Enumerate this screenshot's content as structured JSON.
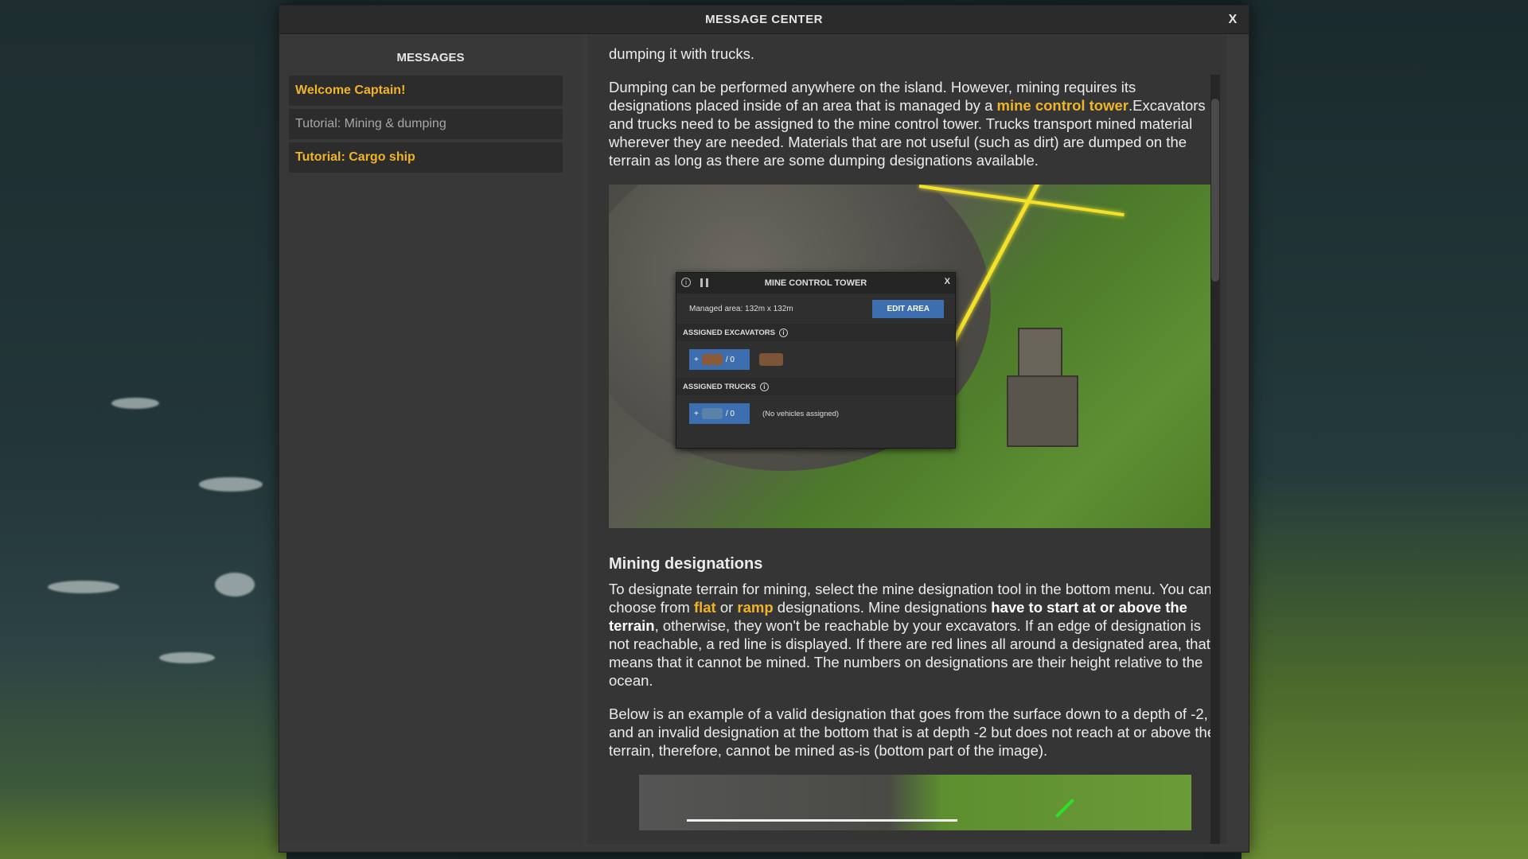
{
  "window": {
    "title": "MESSAGE CENTER",
    "close_label": "X"
  },
  "sidebar": {
    "header": "MESSAGES",
    "items": [
      {
        "label": "Welcome Captain!",
        "state": "unread"
      },
      {
        "label": "Tutorial: Mining & dumping",
        "state": "read"
      },
      {
        "label": "Tutorial: Cargo ship",
        "state": "unread"
      }
    ]
  },
  "content": {
    "p0": "dumping it with trucks.",
    "p1_a": "Dumping can be performed anywhere on the island. However, mining requires its designations placed inside of an area that is managed by a ",
    "p1_link": "mine control tower",
    "p1_b": ".Excavators and trucks need to be assigned to the mine control tower. Trucks transport mined material wherever they are needed. Materials that are not useful (such as dirt) are dumped on the terrain as long as there are some dumping designations available.",
    "image1": {
      "panel_title": "MINE CONTROL TOWER",
      "panel_close": "X",
      "managed_area": "Managed area: 132m x 132m",
      "edit_area": "EDIT AREA",
      "excavators_header": "ASSIGNED EXCAVATORS",
      "excavators_count": "/ 0",
      "trucks_header": "ASSIGNED TRUCKS",
      "trucks_count": "/ 0",
      "no_vehicles": "(No vehicles assigned)"
    },
    "h_mining": "Mining designations",
    "p2_a": "To designate terrain for mining, select the mine designation tool in the bottom menu. You can choose from ",
    "p2_flat": "flat",
    "p2_or": " or ",
    "p2_ramp": "ramp",
    "p2_b": " designations. Mine designations ",
    "p2_bold": "have to start at or above the terrain",
    "p2_c": ", otherwise, they won't be reachable by your excavators. If an edge of designation is not reachable, a red line is displayed. If there are red lines all around a designated area, that means that it cannot be mined. The numbers on designations are their height relative to the ocean.",
    "p3": "Below is an example of a valid designation that goes from the surface down to a depth of -2, and an invalid designation at the bottom that is at depth -2 but does not reach at or above the terrain, therefore, cannot be mined as-is (bottom part of the image)."
  },
  "colors": {
    "accent": "#f0b429",
    "button_blue": "#3d6fb0",
    "area_line": "#f4e12a"
  }
}
